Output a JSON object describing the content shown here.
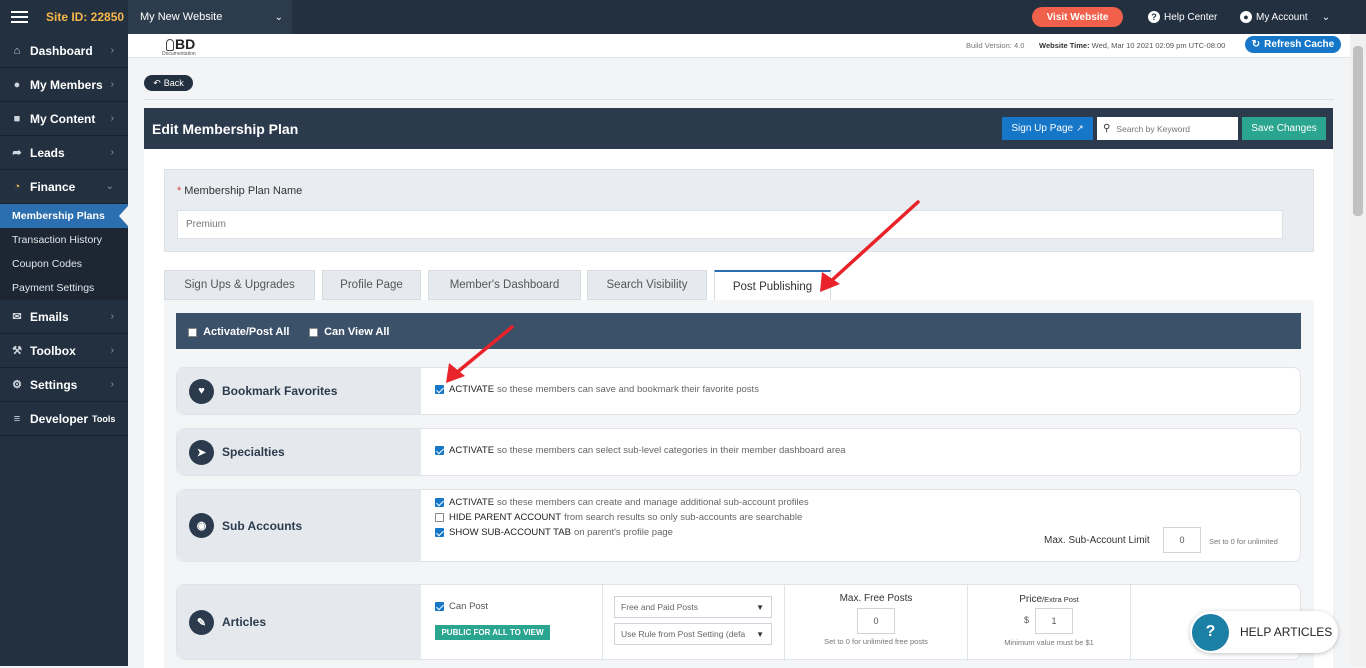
{
  "topbar": {
    "site_id": "Site ID: 22850",
    "site_name": "My New Website",
    "visit_website": "Visit Website",
    "help_center": "Help Center",
    "my_account": "My Account"
  },
  "sidebar": {
    "items": [
      {
        "label": "Dashboard"
      },
      {
        "label": "My Members"
      },
      {
        "label": "My Content"
      },
      {
        "label": "Leads"
      },
      {
        "label": "Finance"
      },
      {
        "label": "Emails"
      },
      {
        "label": "Toolbox"
      },
      {
        "label": "Settings"
      },
      {
        "label": "Developer",
        "suffix": "Tools"
      }
    ],
    "finance_sub": [
      "Membership Plans",
      "Transaction History",
      "Coupon Codes",
      "Payment Settings"
    ]
  },
  "header": {
    "logo": "BD",
    "logo_sub": "Documentation",
    "build_version": "Build Version: 4.0",
    "website_time_label": "Website Time:",
    "website_time": "Wed, Mar 10 2021 02:09 pm UTC-08:00",
    "refresh_cache": "Refresh Cache"
  },
  "back": "Back",
  "panel": {
    "title": "Edit Membership Plan",
    "signup_page": "Sign Up Page",
    "search_placeholder": "Search by Keyword",
    "save_changes": "Save Changes",
    "plan_name_label": "Membership Plan Name",
    "plan_name_value": "Premium"
  },
  "tabs": [
    "Sign Ups & Upgrades",
    "Profile Page",
    "Member's Dashboard",
    "Search Visibility",
    "Post Publishing"
  ],
  "select_bar": {
    "activate_all": "Activate/Post All",
    "view_all": "Can View All"
  },
  "features": {
    "bookmark": {
      "label": "Bookmark Favorites",
      "strong": "ACTIVATE",
      "text": "so these members can save and bookmark their favorite posts"
    },
    "specialties": {
      "label": "Specialties",
      "strong": "ACTIVATE",
      "text": "so these members can select sub-level categories in their member dashboard area"
    },
    "subaccounts": {
      "label": "Sub Accounts",
      "opt1_strong": "ACTIVATE",
      "opt1_text": "so these members can create and manage additional sub-account profiles",
      "opt2_strong": "HIDE PARENT ACCOUNT",
      "opt2_text": "from search results so only sub-accounts are searchable",
      "opt3_strong": "SHOW SUB-ACCOUNT TAB",
      "opt3_text": "on parent's profile page",
      "limit_label": "Max. Sub-Account Limit",
      "limit_value": "0",
      "limit_hint": "Set to 0 for unlimited"
    },
    "articles": {
      "label": "Articles",
      "can_post": "Can Post",
      "public_badge": "PUBLIC FOR ALL TO VIEW",
      "posts_type": "Free and Paid Posts",
      "rule": "Use Rule from Post Setting (defa",
      "max_free_label": "Max. Free Posts",
      "max_free_value": "0",
      "max_free_hint": "Set to 0 for unlimited free posts",
      "price_label": "Price",
      "price_suffix": "/Extra Post",
      "currency": "$",
      "price_value": "1",
      "price_hint": "Minimum value must be $1"
    }
  },
  "help_articles": "HELP ARTICLES",
  "colors": {
    "sidebar": "#22303f",
    "accent_blue": "#1677c9",
    "save_green": "#2aa58f",
    "visit_orange": "#f0604a",
    "annotation_red": "#e8232a"
  }
}
